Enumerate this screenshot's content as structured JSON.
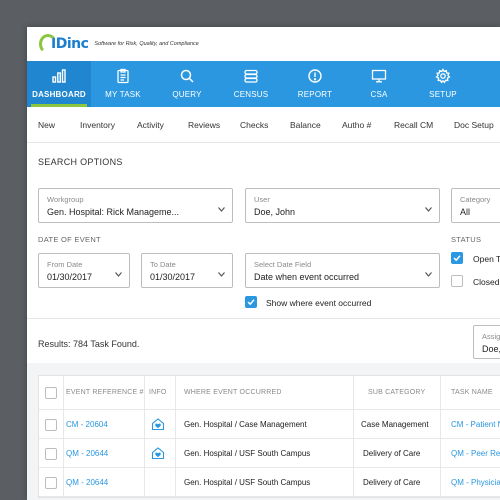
{
  "logo": {
    "text": "IDinc",
    "tagline": "Software for Risk, Quality, and Compliance"
  },
  "nav": [
    {
      "label": "DASHBOARD",
      "icon": "bar-chart-icon",
      "active": true
    },
    {
      "label": "MY TASK",
      "icon": "clipboard-icon"
    },
    {
      "label": "QUERY",
      "icon": "search-icon"
    },
    {
      "label": "CENSUS",
      "icon": "database-icon"
    },
    {
      "label": "REPORT",
      "icon": "alert-circle-icon"
    },
    {
      "label": "CSA",
      "icon": "monitor-icon"
    },
    {
      "label": "SETUP",
      "icon": "gear-icon"
    }
  ],
  "subnav": [
    "New",
    "Inventory",
    "Activity",
    "Reviews",
    "Checks",
    "Balance",
    "Autho #",
    "Recall CM",
    "Doc Setup"
  ],
  "search": {
    "title": "SEARCH OPTIONS",
    "workgroup": {
      "label": "Workgroup",
      "value": "Gen. Hospital: Rick Manageme..."
    },
    "user": {
      "label": "User",
      "value": "Doe, John"
    },
    "category": {
      "label": "Category",
      "value": "All"
    },
    "date_of_event_label": "DATE OF EVENT",
    "from_date": {
      "label": "From Date",
      "value": "01/30/2017"
    },
    "to_date": {
      "label": "To Date",
      "value": "01/30/2017"
    },
    "date_field": {
      "label": "Select Date Field",
      "value": "Date when event occurred"
    },
    "show_where": "Show where event occurred",
    "status_label": "STATUS",
    "status_open": "Open T",
    "status_closed": "Closed"
  },
  "results": {
    "text": "Results: 784 Task Found.",
    "assign": {
      "label": "Assig",
      "value": "Doe,"
    }
  },
  "table": {
    "headers": [
      "EVENT REFERENCE #",
      "INFO",
      "WHERE EVENT OCCURRED",
      "SUB CATEGORY",
      "TASK NAME"
    ],
    "rows": [
      {
        "ref": "CM - 20604",
        "info": true,
        "where": "Gen. Hospital / Case Management",
        "sub": "Case Management",
        "task": "CM - Patient N"
      },
      {
        "ref": "QM - 20644",
        "info": true,
        "where": "Gen. Hospital / USF South Campus",
        "sub": "Delivery of Care",
        "task": "QM - Peer Rev"
      },
      {
        "ref": "QM - 20644",
        "info": false,
        "where": "Gen. Hospital / USF South Campus",
        "sub": "Delivery of Care",
        "task": "QM - Physicia"
      }
    ]
  },
  "colors": {
    "primary": "#2a97e0",
    "accent": "#8cc63f"
  }
}
